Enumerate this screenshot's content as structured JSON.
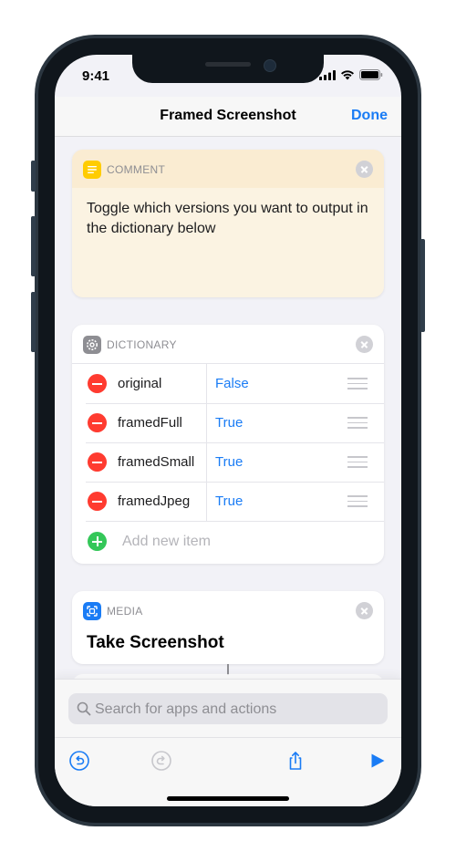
{
  "status_bar": {
    "time": "9:41"
  },
  "nav": {
    "title": "Framed Screenshot",
    "done_label": "Done"
  },
  "comment": {
    "header": "COMMENT",
    "text": "Toggle which versions you want to output in the dictionary below"
  },
  "dictionary": {
    "header": "DICTIONARY",
    "items": [
      {
        "key": "original",
        "value": "False"
      },
      {
        "key": "framedFull",
        "value": "True"
      },
      {
        "key": "framedSmall",
        "value": "True"
      },
      {
        "key": "framedJpeg",
        "value": "True"
      }
    ],
    "add_label": "Add new item"
  },
  "media": {
    "header": "MEDIA",
    "action": "Take Screenshot"
  },
  "search": {
    "placeholder": "Search for apps and actions"
  },
  "toolbar": {
    "icons": [
      "undo-icon",
      "redo-icon",
      "share-icon",
      "play-icon"
    ]
  },
  "colors": {
    "accent": "#1a7cf5",
    "comment_bg": "#fbf3e2",
    "comment_icon": "#ffcc00",
    "dictionary_icon": "#8e8e93",
    "media_icon": "#1a7cf5",
    "remove": "#ff3b30",
    "add": "#34c759"
  }
}
